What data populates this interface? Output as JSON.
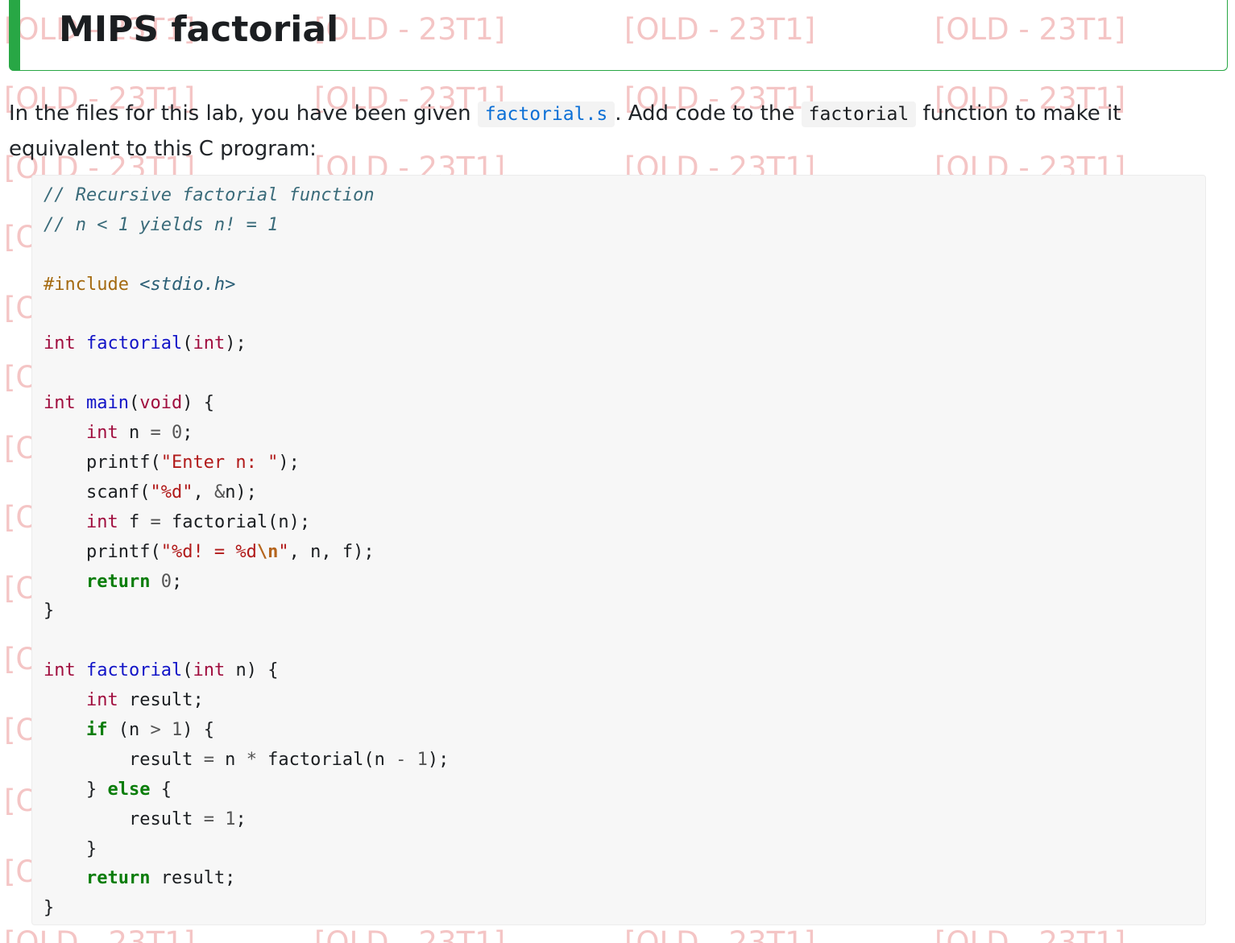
{
  "heading": {
    "title": "MIPS factorial"
  },
  "watermark": {
    "text": "[OLD - 23T1]"
  },
  "intro": {
    "part1": "In the files for this lab, you have been given ",
    "file_link": "factorial.s",
    "part2": ". Add code to the ",
    "function_name": "factorial",
    "part3": " function to make it equivalent to this C program:"
  },
  "code": {
    "language": "c",
    "lines": [
      [
        {
          "t": "comment",
          "v": "// Recursive factorial function"
        }
      ],
      [
        {
          "t": "comment",
          "v": "// n < 1 yields n! = 1"
        }
      ],
      [],
      [
        {
          "t": "preproc",
          "v": "#include "
        },
        {
          "t": "header",
          "v": "<stdio.h>"
        }
      ],
      [],
      [
        {
          "t": "type",
          "v": "int"
        },
        {
          "t": "plain",
          "v": " "
        },
        {
          "t": "func",
          "v": "factorial"
        },
        {
          "t": "plain",
          "v": "("
        },
        {
          "t": "type",
          "v": "int"
        },
        {
          "t": "plain",
          "v": ");"
        }
      ],
      [],
      [
        {
          "t": "type",
          "v": "int"
        },
        {
          "t": "plain",
          "v": " "
        },
        {
          "t": "func",
          "v": "main"
        },
        {
          "t": "plain",
          "v": "("
        },
        {
          "t": "type",
          "v": "void"
        },
        {
          "t": "plain",
          "v": ") {"
        }
      ],
      [
        {
          "t": "plain",
          "v": "    "
        },
        {
          "t": "type",
          "v": "int"
        },
        {
          "t": "plain",
          "v": " n "
        },
        {
          "t": "op",
          "v": "="
        },
        {
          "t": "plain",
          "v": " "
        },
        {
          "t": "num",
          "v": "0"
        },
        {
          "t": "plain",
          "v": ";"
        }
      ],
      [
        {
          "t": "plain",
          "v": "    printf("
        },
        {
          "t": "str",
          "v": "\"Enter n: \""
        },
        {
          "t": "plain",
          "v": ");"
        }
      ],
      [
        {
          "t": "plain",
          "v": "    scanf("
        },
        {
          "t": "str",
          "v": "\"%d\""
        },
        {
          "t": "plain",
          "v": ", "
        },
        {
          "t": "op",
          "v": "&"
        },
        {
          "t": "plain",
          "v": "n);"
        }
      ],
      [
        {
          "t": "plain",
          "v": "    "
        },
        {
          "t": "type",
          "v": "int"
        },
        {
          "t": "plain",
          "v": " f "
        },
        {
          "t": "op",
          "v": "="
        },
        {
          "t": "plain",
          "v": " factorial(n);"
        }
      ],
      [
        {
          "t": "plain",
          "v": "    printf("
        },
        {
          "t": "str",
          "v": "\"%d! = %d"
        },
        {
          "t": "esc",
          "v": "\\n"
        },
        {
          "t": "str",
          "v": "\""
        },
        {
          "t": "plain",
          "v": ", n, f);"
        }
      ],
      [
        {
          "t": "plain",
          "v": "    "
        },
        {
          "t": "kw",
          "v": "return"
        },
        {
          "t": "plain",
          "v": " "
        },
        {
          "t": "num",
          "v": "0"
        },
        {
          "t": "plain",
          "v": ";"
        }
      ],
      [
        {
          "t": "plain",
          "v": "}"
        }
      ],
      [],
      [
        {
          "t": "type",
          "v": "int"
        },
        {
          "t": "plain",
          "v": " "
        },
        {
          "t": "func",
          "v": "factorial"
        },
        {
          "t": "plain",
          "v": "("
        },
        {
          "t": "type",
          "v": "int"
        },
        {
          "t": "plain",
          "v": " n) {"
        }
      ],
      [
        {
          "t": "plain",
          "v": "    "
        },
        {
          "t": "type",
          "v": "int"
        },
        {
          "t": "plain",
          "v": " result;"
        }
      ],
      [
        {
          "t": "plain",
          "v": "    "
        },
        {
          "t": "kw",
          "v": "if"
        },
        {
          "t": "plain",
          "v": " (n "
        },
        {
          "t": "op",
          "v": ">"
        },
        {
          "t": "plain",
          "v": " "
        },
        {
          "t": "num",
          "v": "1"
        },
        {
          "t": "plain",
          "v": ") {"
        }
      ],
      [
        {
          "t": "plain",
          "v": "        result "
        },
        {
          "t": "op",
          "v": "="
        },
        {
          "t": "plain",
          "v": " n "
        },
        {
          "t": "op",
          "v": "*"
        },
        {
          "t": "plain",
          "v": " factorial(n "
        },
        {
          "t": "op",
          "v": "-"
        },
        {
          "t": "plain",
          "v": " "
        },
        {
          "t": "num",
          "v": "1"
        },
        {
          "t": "plain",
          "v": ");"
        }
      ],
      [
        {
          "t": "plain",
          "v": "    } "
        },
        {
          "t": "kw",
          "v": "else"
        },
        {
          "t": "plain",
          "v": " {"
        }
      ],
      [
        {
          "t": "plain",
          "v": "        result "
        },
        {
          "t": "op",
          "v": "="
        },
        {
          "t": "plain",
          "v": " "
        },
        {
          "t": "num",
          "v": "1"
        },
        {
          "t": "plain",
          "v": ";"
        }
      ],
      [
        {
          "t": "plain",
          "v": "    }"
        }
      ],
      [
        {
          "t": "plain",
          "v": "    "
        },
        {
          "t": "kw",
          "v": "return"
        },
        {
          "t": "plain",
          "v": " result;"
        }
      ],
      [
        {
          "t": "plain",
          "v": "}"
        }
      ]
    ]
  },
  "colors": {
    "accent": "#28a745",
    "link": "#0b6fd6",
    "watermark": "#f3bcbc",
    "code_background": "#f7f7f7"
  }
}
